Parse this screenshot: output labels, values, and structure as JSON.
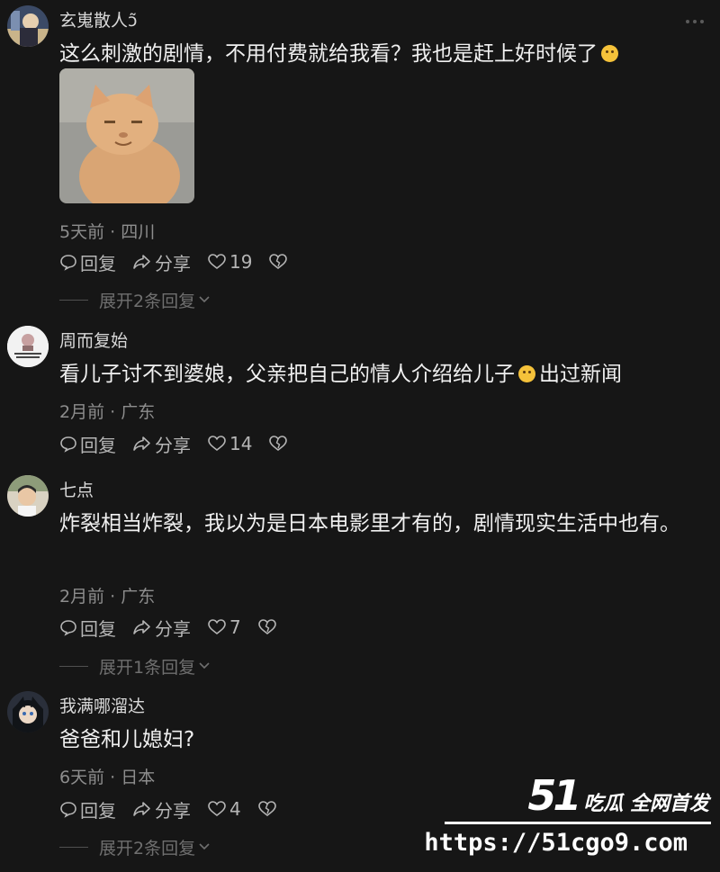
{
  "comments": [
    {
      "username": "玄嵬散人ↄ̃",
      "content_before": "这么刺激的剧情，不用付费就给我看？我也是赶上好时候了",
      "content_after": "",
      "emoji": "crying-face-emoji",
      "time": "5天前 · 四川",
      "reply_label": "回复",
      "share_label": "分享",
      "likes": "19",
      "expand_label": "展开2条回复",
      "has_image": true,
      "image_desc": "cat-photo"
    },
    {
      "username": "周而复始",
      "content_before": "看儿子讨不到婆娘，父亲把自己的情人介绍给儿子",
      "content_after": "出过新闻",
      "emoji": "grimacing-face-emoji",
      "time": "2月前 · 广东",
      "reply_label": "回复",
      "share_label": "分享",
      "likes": "14"
    },
    {
      "username": "七点",
      "content_before": "炸裂相当炸裂，我以为是日本电影里才有的，剧情现实生活中也有。",
      "time": "2月前 · 广东",
      "reply_label": "回复",
      "share_label": "分享",
      "likes": "7",
      "expand_label": "展开1条回复"
    },
    {
      "username": "我满哪溜达",
      "content_before": "爸爸和儿媳妇?",
      "time": "6天前 · 日本",
      "reply_label": "回复",
      "share_label": "分享",
      "likes": "4",
      "expand_label": "展开2条回复"
    }
  ],
  "watermark": {
    "logo_number": "51",
    "logo_text": "吃瓜 全网首发",
    "url": "https://51cgo9.com"
  },
  "colors": {
    "background": "#161616",
    "text": "#f0f0f0",
    "meta": "#8d8d8d"
  }
}
